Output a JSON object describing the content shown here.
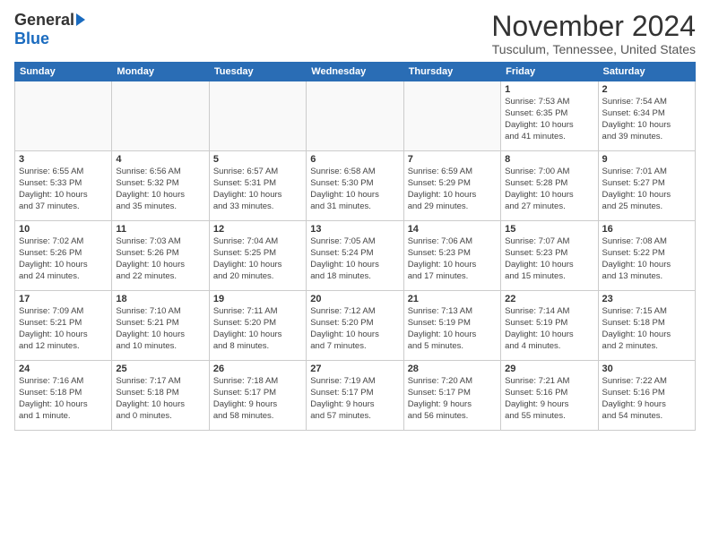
{
  "logo": {
    "general": "General",
    "blue": "Blue"
  },
  "title": "November 2024",
  "subtitle": "Tusculum, Tennessee, United States",
  "headers": [
    "Sunday",
    "Monday",
    "Tuesday",
    "Wednesday",
    "Thursday",
    "Friday",
    "Saturday"
  ],
  "weeks": [
    [
      {
        "day": "",
        "info": ""
      },
      {
        "day": "",
        "info": ""
      },
      {
        "day": "",
        "info": ""
      },
      {
        "day": "",
        "info": ""
      },
      {
        "day": "",
        "info": ""
      },
      {
        "day": "1",
        "info": "Sunrise: 7:53 AM\nSunset: 6:35 PM\nDaylight: 10 hours\nand 41 minutes."
      },
      {
        "day": "2",
        "info": "Sunrise: 7:54 AM\nSunset: 6:34 PM\nDaylight: 10 hours\nand 39 minutes."
      }
    ],
    [
      {
        "day": "3",
        "info": "Sunrise: 6:55 AM\nSunset: 5:33 PM\nDaylight: 10 hours\nand 37 minutes."
      },
      {
        "day": "4",
        "info": "Sunrise: 6:56 AM\nSunset: 5:32 PM\nDaylight: 10 hours\nand 35 minutes."
      },
      {
        "day": "5",
        "info": "Sunrise: 6:57 AM\nSunset: 5:31 PM\nDaylight: 10 hours\nand 33 minutes."
      },
      {
        "day": "6",
        "info": "Sunrise: 6:58 AM\nSunset: 5:30 PM\nDaylight: 10 hours\nand 31 minutes."
      },
      {
        "day": "7",
        "info": "Sunrise: 6:59 AM\nSunset: 5:29 PM\nDaylight: 10 hours\nand 29 minutes."
      },
      {
        "day": "8",
        "info": "Sunrise: 7:00 AM\nSunset: 5:28 PM\nDaylight: 10 hours\nand 27 minutes."
      },
      {
        "day": "9",
        "info": "Sunrise: 7:01 AM\nSunset: 5:27 PM\nDaylight: 10 hours\nand 25 minutes."
      }
    ],
    [
      {
        "day": "10",
        "info": "Sunrise: 7:02 AM\nSunset: 5:26 PM\nDaylight: 10 hours\nand 24 minutes."
      },
      {
        "day": "11",
        "info": "Sunrise: 7:03 AM\nSunset: 5:26 PM\nDaylight: 10 hours\nand 22 minutes."
      },
      {
        "day": "12",
        "info": "Sunrise: 7:04 AM\nSunset: 5:25 PM\nDaylight: 10 hours\nand 20 minutes."
      },
      {
        "day": "13",
        "info": "Sunrise: 7:05 AM\nSunset: 5:24 PM\nDaylight: 10 hours\nand 18 minutes."
      },
      {
        "day": "14",
        "info": "Sunrise: 7:06 AM\nSunset: 5:23 PM\nDaylight: 10 hours\nand 17 minutes."
      },
      {
        "day": "15",
        "info": "Sunrise: 7:07 AM\nSunset: 5:23 PM\nDaylight: 10 hours\nand 15 minutes."
      },
      {
        "day": "16",
        "info": "Sunrise: 7:08 AM\nSunset: 5:22 PM\nDaylight: 10 hours\nand 13 minutes."
      }
    ],
    [
      {
        "day": "17",
        "info": "Sunrise: 7:09 AM\nSunset: 5:21 PM\nDaylight: 10 hours\nand 12 minutes."
      },
      {
        "day": "18",
        "info": "Sunrise: 7:10 AM\nSunset: 5:21 PM\nDaylight: 10 hours\nand 10 minutes."
      },
      {
        "day": "19",
        "info": "Sunrise: 7:11 AM\nSunset: 5:20 PM\nDaylight: 10 hours\nand 8 minutes."
      },
      {
        "day": "20",
        "info": "Sunrise: 7:12 AM\nSunset: 5:20 PM\nDaylight: 10 hours\nand 7 minutes."
      },
      {
        "day": "21",
        "info": "Sunrise: 7:13 AM\nSunset: 5:19 PM\nDaylight: 10 hours\nand 5 minutes."
      },
      {
        "day": "22",
        "info": "Sunrise: 7:14 AM\nSunset: 5:19 PM\nDaylight: 10 hours\nand 4 minutes."
      },
      {
        "day": "23",
        "info": "Sunrise: 7:15 AM\nSunset: 5:18 PM\nDaylight: 10 hours\nand 2 minutes."
      }
    ],
    [
      {
        "day": "24",
        "info": "Sunrise: 7:16 AM\nSunset: 5:18 PM\nDaylight: 10 hours\nand 1 minute."
      },
      {
        "day": "25",
        "info": "Sunrise: 7:17 AM\nSunset: 5:18 PM\nDaylight: 10 hours\nand 0 minutes."
      },
      {
        "day": "26",
        "info": "Sunrise: 7:18 AM\nSunset: 5:17 PM\nDaylight: 9 hours\nand 58 minutes."
      },
      {
        "day": "27",
        "info": "Sunrise: 7:19 AM\nSunset: 5:17 PM\nDaylight: 9 hours\nand 57 minutes."
      },
      {
        "day": "28",
        "info": "Sunrise: 7:20 AM\nSunset: 5:17 PM\nDaylight: 9 hours\nand 56 minutes."
      },
      {
        "day": "29",
        "info": "Sunrise: 7:21 AM\nSunset: 5:16 PM\nDaylight: 9 hours\nand 55 minutes."
      },
      {
        "day": "30",
        "info": "Sunrise: 7:22 AM\nSunset: 5:16 PM\nDaylight: 9 hours\nand 54 minutes."
      }
    ]
  ]
}
